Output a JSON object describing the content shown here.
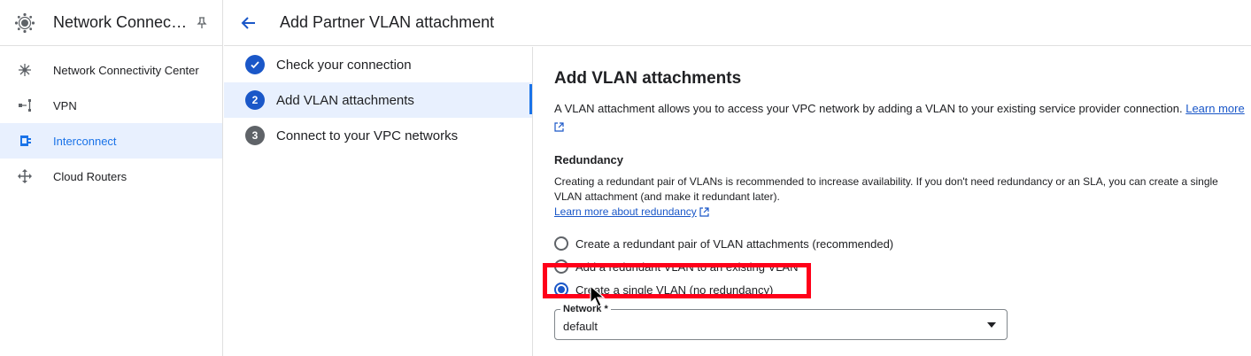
{
  "nav": {
    "title": "Network Connectivity",
    "title_display": "Network Connecti…",
    "items": [
      {
        "label": "Network Connectivity Center",
        "icon": "hub-icon",
        "active": false
      },
      {
        "label": "VPN",
        "icon": "vpn-icon",
        "active": false
      },
      {
        "label": "Interconnect",
        "icon": "interconnect-icon",
        "active": true
      },
      {
        "label": "Cloud Routers",
        "icon": "router-icon",
        "active": false
      }
    ]
  },
  "header": {
    "title": "Add Partner VLAN attachment"
  },
  "stepper": {
    "steps": [
      {
        "label": "Check your connection",
        "state": "done"
      },
      {
        "number": "2",
        "label": "Add VLAN attachments",
        "state": "active"
      },
      {
        "number": "3",
        "label": "Connect to your VPC networks",
        "state": "pending"
      }
    ]
  },
  "content": {
    "heading": "Add VLAN attachments",
    "description": "A VLAN attachment allows you to access your VPC network by adding a VLAN to your existing service provider connection.",
    "learn_more": "Learn more",
    "redundancy_label": "Redundancy",
    "redundancy_help": "Creating a redundant pair of VLANs is recommended to increase availability. If you don't need redundancy or an SLA, you can create a single VLAN attachment (and make it redundant later).",
    "redundancy_link": "Learn more about redundancy",
    "options": [
      {
        "label": "Create a redundant pair of VLAN attachments (recommended)",
        "checked": false
      },
      {
        "label": "Add a redundant VLAN to an existing VLAN",
        "checked": false
      },
      {
        "label": "Create a single VLAN (no redundancy)",
        "checked": true
      }
    ],
    "network_label": "Network *",
    "network_value": "default"
  },
  "colors": {
    "accent": "#1a57c8",
    "highlight": "#ff0019",
    "active_bg": "#e8f0fe"
  }
}
